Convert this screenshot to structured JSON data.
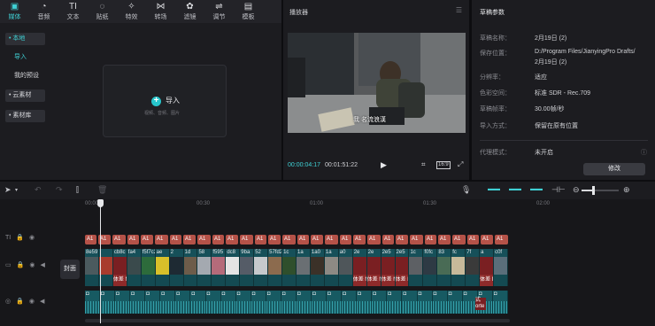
{
  "toolbar": {
    "items": [
      {
        "label": "媒体",
        "icon": "media-icon",
        "glyph": "▣",
        "active": true
      },
      {
        "label": "音频",
        "icon": "audio-icon",
        "glyph": "◔"
      },
      {
        "label": "文本",
        "icon": "text-icon",
        "glyph": "TI"
      },
      {
        "label": "贴纸",
        "icon": "sticker-icon",
        "glyph": "◌"
      },
      {
        "label": "特效",
        "icon": "effects-icon",
        "glyph": "✧"
      },
      {
        "label": "转场",
        "icon": "transition-icon",
        "glyph": "⋈"
      },
      {
        "label": "滤镜",
        "icon": "filter-icon",
        "glyph": "✿"
      },
      {
        "label": "调节",
        "icon": "adjust-icon",
        "glyph": "⇌"
      },
      {
        "label": "模板",
        "icon": "template-icon",
        "glyph": "▤"
      }
    ]
  },
  "leftnav": {
    "local": "• 本地",
    "import": "导入",
    "presets": "我的预设",
    "cloud": "• 云素材",
    "library": "• 素材库"
  },
  "media": {
    "import_label": "导入",
    "import_hint": "视频、音频、图片"
  },
  "player": {
    "title": "播放器",
    "current_time": "00:00:04:17",
    "duration": "00:01:51:22",
    "ratio": "16:9",
    "subtitle": "我 名流浪漢"
  },
  "params": {
    "title": "草稿参数",
    "rows": [
      {
        "k": "草稿名称：",
        "v": "2月19日 (2)"
      },
      {
        "k": "保存位置：",
        "v": "D:/Program Files/JianyingPro Drafts/"
      },
      {
        "k": "",
        "v": "2月19日 (2)"
      },
      {
        "k": "分辨率：",
        "v": "适应"
      },
      {
        "k": "色彩空间：",
        "v": "标准 SDR - Rec.709"
      },
      {
        "k": "草稿帧率：",
        "v": "30.00帧/秒"
      },
      {
        "k": "导入方式：",
        "v": "保留在原有位置"
      },
      {
        "k": "代理模式：",
        "v": "未开启"
      }
    ],
    "modify_button": "修改"
  },
  "timeline": {
    "ticks": [
      "00:00",
      "00:30",
      "01:00",
      "01:30",
      "02:00"
    ],
    "cover_label": "封面",
    "text_chip": "A1",
    "video_clips": [
      {
        "hd": "8e59",
        "ft": "",
        "color": "#4b5a5e"
      },
      {
        "hd": "",
        "ft": "",
        "color": "#a83b2d"
      },
      {
        "hd": "cb8c",
        "ft": "体差 Not",
        "color": "#7a1f22"
      },
      {
        "hd": "fa4",
        "ft": "",
        "color": "#3a4a4c"
      },
      {
        "hd": "f5f7c2",
        "ft": "",
        "color": "#2d6b3b"
      },
      {
        "hd": "ae",
        "ft": "",
        "color": "#d8c02a"
      },
      {
        "hd": "2",
        "ft": "",
        "color": "#1e2a33"
      },
      {
        "hd": "1d",
        "ft": "",
        "color": "#6d5c4a"
      },
      {
        "hd": "58",
        "ft": "",
        "color": "#a4a9b0"
      },
      {
        "hd": "f595",
        "ft": "",
        "color": "#b56b7a"
      },
      {
        "hd": "dc8",
        "ft": "",
        "color": "#e4e4e4"
      },
      {
        "hd": "9ba",
        "ft": "",
        "color": "#555c67"
      },
      {
        "hd": "52",
        "ft": "",
        "color": "#c6c9cc"
      },
      {
        "hd": "57fd230af2ec",
        "ft": "",
        "color": "#8c6b4e"
      },
      {
        "hd": "1c",
        "ft": "",
        "color": "#2f4f2c"
      },
      {
        "hd": "1a",
        "ft": "",
        "color": "#6a6f73"
      },
      {
        "hd": "1a0",
        "ft": "",
        "color": "#3b3128"
      },
      {
        "hd": "1a",
        "ft": "",
        "color": "#8d8a84"
      },
      {
        "hd": "a0",
        "ft": "",
        "color": "#4f565a"
      },
      {
        "hd": "2e",
        "ft": "体差 Not",
        "color": "#7a1f22"
      },
      {
        "hd": "2e",
        "ft": "体差 Not",
        "color": "#7a1f22"
      },
      {
        "hd": "2e5",
        "ft": "体差 Not",
        "color": "#7a1f22"
      },
      {
        "hd": "2e5",
        "ft": "体差 Not",
        "color": "#7a1f22"
      },
      {
        "hd": "1c",
        "ft": "",
        "color": "#5d6064"
      },
      {
        "hd": "f0fc",
        "ft": "",
        "color": "#2e3a44"
      },
      {
        "hd": "83",
        "ft": "",
        "color": "#496b55"
      },
      {
        "hd": "fc",
        "ft": "",
        "color": "#c7b99a"
      },
      {
        "hd": "7f",
        "ft": "",
        "color": "#3a3a3a"
      },
      {
        "hd": "a",
        "ft": "体差 Not",
        "color": "#7a1f22"
      },
      {
        "hd": "c0f",
        "ft": "",
        "color": "#5a6e7a"
      }
    ],
    "audio_tail": "式 orte"
  }
}
